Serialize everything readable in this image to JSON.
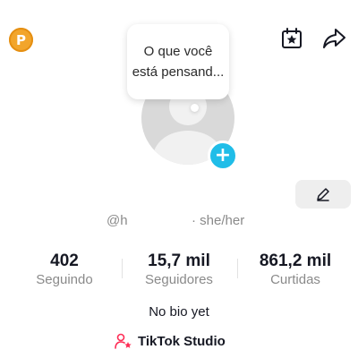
{
  "header": {
    "coin_label": "P",
    "calendar_icon": "calendar-star-icon",
    "share_icon": "share-arrow-icon"
  },
  "avatar": {
    "thought_text": "O que você está pensand...",
    "add_icon": "plus",
    "add_button_color": "#20bde8"
  },
  "profile": {
    "username": "@h",
    "pronouns": "· she/her",
    "bio": "No bio yet"
  },
  "stats": [
    {
      "value": "402",
      "label": "Seguindo"
    },
    {
      "value": "15,7 mil",
      "label": "Seguidores"
    },
    {
      "value": "861,2 mil",
      "label": "Curtidas"
    }
  ],
  "studio": {
    "label": "TikTok Studio",
    "icon": "person-star-icon",
    "icon_color": "#fe2c55"
  },
  "colors": {
    "coin": "#f2a52b",
    "text_primary": "#161823",
    "text_secondary": "#8a8a8a"
  }
}
